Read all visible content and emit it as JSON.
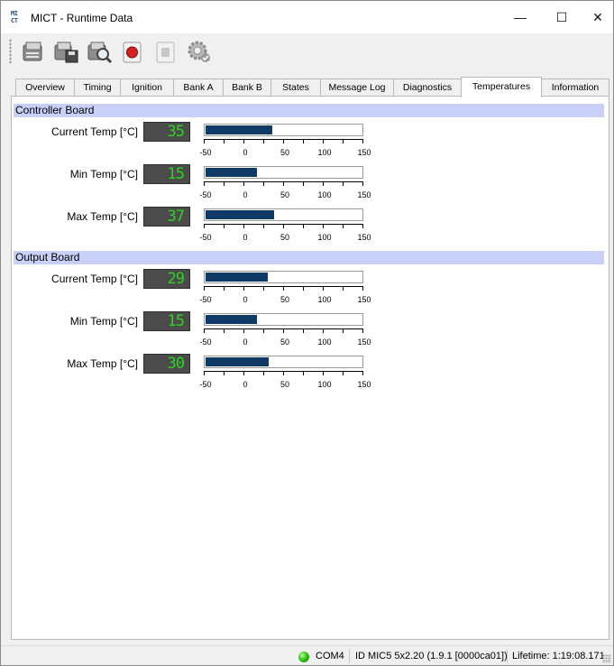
{
  "window": {
    "title": "MICT - Runtime Data",
    "app_icon_text": "MI\nCT",
    "controls": {
      "minimize": "—",
      "maximize": "☐",
      "close": "✕"
    }
  },
  "toolbar": {
    "buttons": [
      {
        "name": "connect-icon"
      },
      {
        "name": "save-icon"
      },
      {
        "name": "inspect-icon"
      },
      {
        "name": "record-icon"
      },
      {
        "name": "stop-icon"
      },
      {
        "name": "settings-icon"
      }
    ]
  },
  "tabs": [
    {
      "label": "Overview"
    },
    {
      "label": "Timing"
    },
    {
      "label": "Ignition"
    },
    {
      "label": "Bank A"
    },
    {
      "label": "Bank B"
    },
    {
      "label": "States"
    },
    {
      "label": "Message Log"
    },
    {
      "label": "Diagnostics"
    },
    {
      "label": "Temperatures",
      "active": true
    },
    {
      "label": "Information"
    }
  ],
  "scale": {
    "min": -50,
    "max": 150,
    "labels": [
      "-50",
      "0",
      "50",
      "100",
      "150"
    ]
  },
  "sections": [
    {
      "title": "Controller Board",
      "rows": [
        {
          "label": "Current Temp [°C]",
          "display": "35",
          "value": 35
        },
        {
          "label": "Min Temp [°C]",
          "display": "15",
          "value": 15
        },
        {
          "label": "Max Temp [°C]",
          "display": "37",
          "value": 37
        }
      ]
    },
    {
      "title": "Output Board",
      "rows": [
        {
          "label": "Current Temp [°C]",
          "display": "29",
          "value": 29
        },
        {
          "label": "Min Temp [°C]",
          "display": "15",
          "value": 15
        },
        {
          "label": "Max Temp [°C]",
          "display": "30",
          "value": 30
        }
      ]
    }
  ],
  "status": {
    "port": "COM4",
    "device": "ID MIC5 5x2.20 (1.9.1 [0000ca01])",
    "lifetime": "Lifetime: 1:19:08.171",
    "led_color": "#35c31a"
  },
  "colors": {
    "section_header": "#c9d0f8",
    "bar_fill": "#0f3a66",
    "lcd_bg": "#4b4b4b",
    "lcd_digits": "#2bd41e"
  }
}
